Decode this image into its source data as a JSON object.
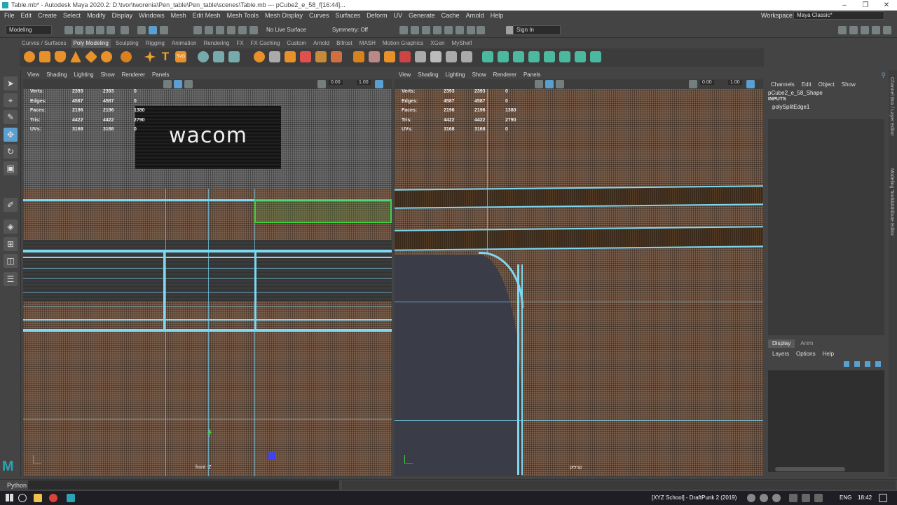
{
  "window": {
    "title": "Table.mb* - Autodesk Maya 2020.2: D:\\tvor\\tworenia\\Pen_table\\Pen_table\\scenes\\Table.mb  ---  pCube2_e_58_f[16:44]..."
  },
  "menu": [
    "File",
    "Edit",
    "Create",
    "Select",
    "Modify",
    "Display",
    "Windows",
    "Mesh",
    "Edit Mesh",
    "Mesh Tools",
    "Mesh Display",
    "Curves",
    "Surfaces",
    "Deform",
    "UV",
    "Generate",
    "Cache",
    "Arnold",
    "Help"
  ],
  "workspace": {
    "label": "Workspace :",
    "value": "Maya Classic*"
  },
  "status": {
    "mode": "Modeling",
    "live": "No Live Surface",
    "symmetry": "Symmetry: Off",
    "signin": "Sign In"
  },
  "shelf_tabs": [
    "Curves / Surfaces",
    "Poly Modeling",
    "Sculpting",
    "Rigging",
    "Animation",
    "Rendering",
    "FX",
    "FX Caching",
    "Custom",
    "Arnold",
    "Bifrost",
    "MASH",
    "Motion Graphics",
    "XGen",
    "MyShelf"
  ],
  "panel_menu": [
    "View",
    "Shading",
    "Lighting",
    "Show",
    "Renderer",
    "Panels"
  ],
  "viewport_fields": {
    "near": "0.00",
    "far": "1.00"
  },
  "hud": {
    "labels": [
      "Verts:",
      "Edges:",
      "Faces:",
      "Tris:",
      "UVs:"
    ],
    "left": [
      [
        "2393",
        "2393",
        "0"
      ],
      [
        "4587",
        "4587",
        "0"
      ],
      [
        "2196",
        "2196",
        "1380"
      ],
      [
        "4422",
        "4422",
        "2790"
      ],
      [
        "3168",
        "3168",
        "0"
      ]
    ],
    "right": [
      [
        "2393",
        "2393",
        "0"
      ],
      [
        "4587",
        "4587",
        "0"
      ],
      [
        "2196",
        "2196",
        "1380"
      ],
      [
        "4422",
        "4422",
        "2790"
      ],
      [
        "3168",
        "3168",
        "0"
      ]
    ]
  },
  "wacom_text": "wacom",
  "camera_left": "front -Z",
  "camera_right": "persp",
  "channel_box": {
    "menu": [
      "Channels",
      "Edit",
      "Object",
      "Show"
    ],
    "object": "pCube2_e_58_Shape",
    "inputs": "INPUTS",
    "node": "polySplitEdge1"
  },
  "layer_editor": {
    "tabs": [
      "Display",
      "Anim"
    ],
    "menu": [
      "Layers",
      "Options",
      "Help"
    ]
  },
  "side_tabs": [
    "Channel Box / Layer Editor",
    "Modeling Toolkit",
    "Attribute Editor"
  ],
  "cmd": {
    "label": "Python"
  },
  "taskbar": {
    "app": "[XYZ School] - DraftPunk 2 (2019)",
    "lang": "ENG",
    "time": "18:42"
  },
  "colors": {
    "maya_bg": "#444444",
    "wire": "#7fd8f0",
    "selection": "#3fd13f",
    "viewport": "#7a5e4b"
  }
}
